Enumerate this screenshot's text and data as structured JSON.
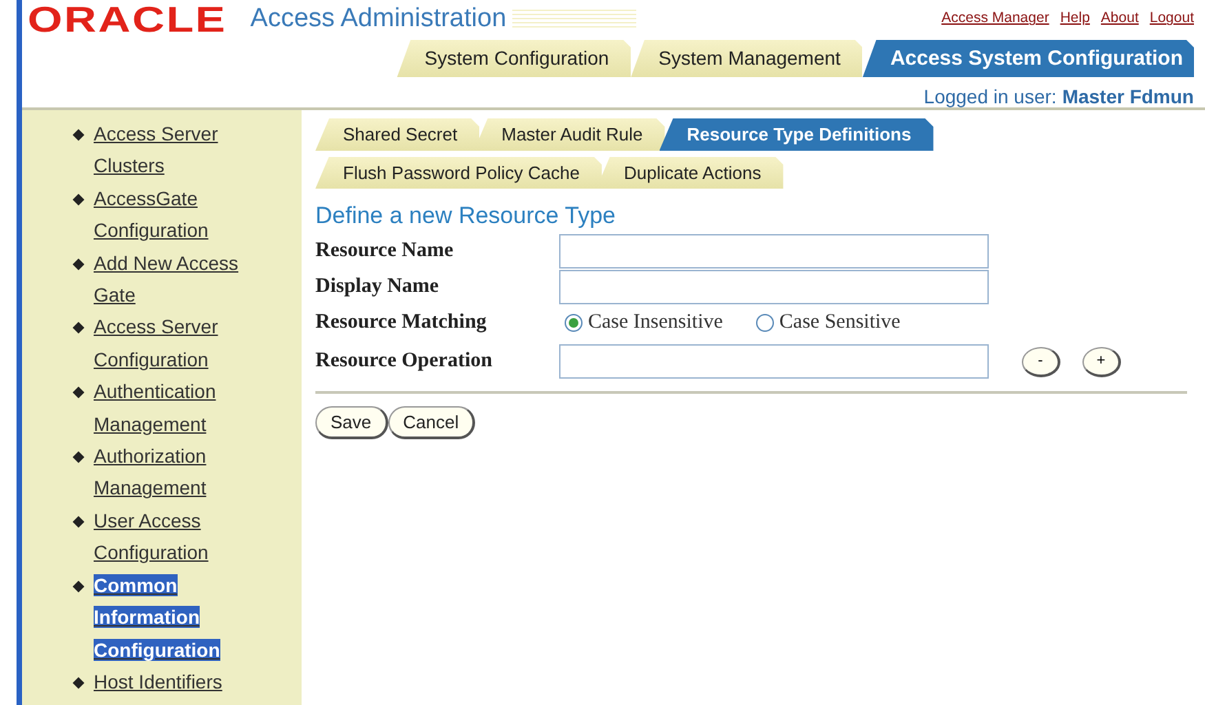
{
  "header": {
    "logo": "ORACLE",
    "title": "Access Administration",
    "links": [
      "Access Manager",
      "Help",
      "About",
      "Logout"
    ],
    "tabs": [
      {
        "label": "System Configuration",
        "selected": false
      },
      {
        "label": "System Management",
        "selected": false
      },
      {
        "label": "Access System Configuration",
        "selected": true
      }
    ],
    "user_label": "Logged in user:",
    "user_name": "Master Fdmun"
  },
  "sidebar": {
    "items": [
      {
        "label": "Access Server Clusters",
        "selected": false
      },
      {
        "label": "AccessGate Configuration",
        "selected": false
      },
      {
        "label": "Add New Access Gate",
        "selected": false
      },
      {
        "label": "Access Server Configuration",
        "selected": false
      },
      {
        "label": "Authentication Management",
        "selected": false
      },
      {
        "label": "Authorization Management",
        "selected": false
      },
      {
        "label": "User Access Configuration",
        "selected": false
      },
      {
        "label": "Common Information Configuration",
        "selected": true
      },
      {
        "label": "Host Identifiers",
        "selected": false
      }
    ]
  },
  "subtabs": [
    [
      {
        "label": "Shared Secret",
        "selected": false
      },
      {
        "label": "Master Audit Rule",
        "selected": false
      },
      {
        "label": "Resource Type Definitions",
        "selected": true
      }
    ],
    [
      {
        "label": "Flush Password Policy Cache",
        "selected": false
      },
      {
        "label": "Duplicate Actions",
        "selected": false
      }
    ]
  ],
  "form": {
    "heading": "Define a new Resource Type",
    "fields": [
      {
        "kind": "text",
        "label": "Resource Name"
      },
      {
        "kind": "text",
        "label": "Display Name"
      },
      {
        "kind": "radio",
        "label": "Resource Matching",
        "options": [
          {
            "label": "Case Insensitive",
            "selected": true
          },
          {
            "label": "Case Sensitive",
            "selected": false
          }
        ]
      },
      {
        "kind": "list",
        "label": "Resource Operation",
        "buttons": [
          "-",
          "+"
        ]
      }
    ],
    "buttons": [
      "Save",
      "Cancel"
    ]
  }
}
